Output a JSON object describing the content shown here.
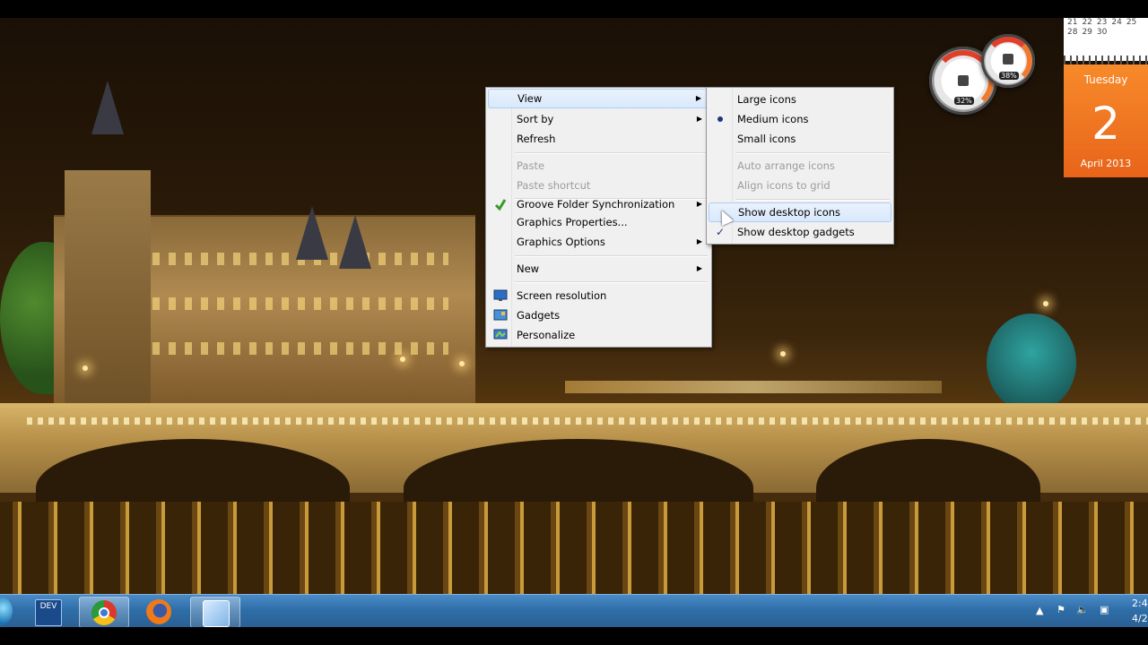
{
  "context_menu": {
    "items": [
      {
        "label": "View",
        "has_submenu": true,
        "state": "highlighted"
      },
      {
        "label": "Sort by",
        "has_submenu": true
      },
      {
        "label": "Refresh"
      },
      {
        "label": "Paste",
        "state": "disabled"
      },
      {
        "label": "Paste shortcut",
        "state": "disabled"
      },
      {
        "label": "Groove Folder Synchronization",
        "has_submenu": true,
        "icon": "groove-icon"
      },
      {
        "label": "Graphics Properties..."
      },
      {
        "label": "Graphics Options",
        "has_submenu": true
      },
      {
        "label": "New",
        "has_submenu": true
      },
      {
        "label": "Screen resolution",
        "icon": "screen-resolution-icon"
      },
      {
        "label": "Gadgets",
        "icon": "gadgets-icon"
      },
      {
        "label": "Personalize",
        "icon": "personalize-icon"
      }
    ]
  },
  "view_submenu": {
    "items": [
      {
        "label": "Large icons"
      },
      {
        "label": "Medium icons",
        "selected": true
      },
      {
        "label": "Small icons"
      },
      {
        "label": "Auto arrange icons",
        "state": "disabled"
      },
      {
        "label": "Align icons to grid",
        "state": "disabled"
      },
      {
        "label": "Show desktop icons",
        "state": "hovered"
      },
      {
        "label": "Show desktop gadgets",
        "checked": true
      }
    ]
  },
  "gadgets": {
    "cpu_meter": {
      "left_value": "32%",
      "right_value": "38%"
    },
    "calendar": {
      "week_rows": [
        [
          "21",
          "22",
          "23",
          "24",
          "25"
        ],
        [
          "28",
          "29",
          "30"
        ]
      ],
      "weekday": "Tuesday",
      "day": "2",
      "month_year": "April 2013"
    }
  },
  "taskbar": {
    "apps": [
      {
        "name": "dev-app",
        "label": "DEV",
        "active": false
      },
      {
        "name": "chrome",
        "active": true
      },
      {
        "name": "firefox",
        "active": false
      },
      {
        "name": "window-app",
        "active": true
      }
    ],
    "clock": {
      "time": "2:4",
      "date": "4/2"
    }
  },
  "colors": {
    "menu_bg": "#f0f0f0",
    "menu_highlight": "#d9e8fb",
    "calendar_orange": "#f0781f",
    "taskbar_blue": "#2f6ea8"
  }
}
